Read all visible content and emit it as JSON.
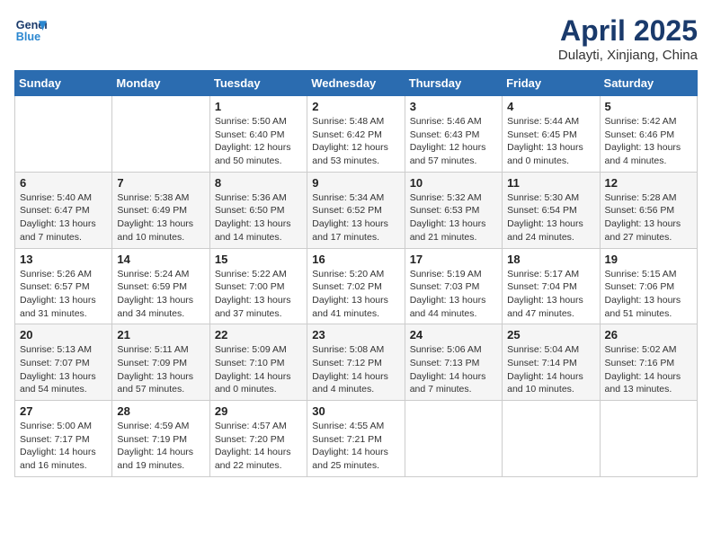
{
  "header": {
    "logo_line1": "General",
    "logo_line2": "Blue",
    "month_title": "April 2025",
    "location": "Dulayti, Xinjiang, China"
  },
  "weekdays": [
    "Sunday",
    "Monday",
    "Tuesday",
    "Wednesday",
    "Thursday",
    "Friday",
    "Saturday"
  ],
  "weeks": [
    [
      {
        "day": "",
        "info": ""
      },
      {
        "day": "",
        "info": ""
      },
      {
        "day": "1",
        "info": "Sunrise: 5:50 AM\nSunset: 6:40 PM\nDaylight: 12 hours and 50 minutes."
      },
      {
        "day": "2",
        "info": "Sunrise: 5:48 AM\nSunset: 6:42 PM\nDaylight: 12 hours and 53 minutes."
      },
      {
        "day": "3",
        "info": "Sunrise: 5:46 AM\nSunset: 6:43 PM\nDaylight: 12 hours and 57 minutes."
      },
      {
        "day": "4",
        "info": "Sunrise: 5:44 AM\nSunset: 6:45 PM\nDaylight: 13 hours and 0 minutes."
      },
      {
        "day": "5",
        "info": "Sunrise: 5:42 AM\nSunset: 6:46 PM\nDaylight: 13 hours and 4 minutes."
      }
    ],
    [
      {
        "day": "6",
        "info": "Sunrise: 5:40 AM\nSunset: 6:47 PM\nDaylight: 13 hours and 7 minutes."
      },
      {
        "day": "7",
        "info": "Sunrise: 5:38 AM\nSunset: 6:49 PM\nDaylight: 13 hours and 10 minutes."
      },
      {
        "day": "8",
        "info": "Sunrise: 5:36 AM\nSunset: 6:50 PM\nDaylight: 13 hours and 14 minutes."
      },
      {
        "day": "9",
        "info": "Sunrise: 5:34 AM\nSunset: 6:52 PM\nDaylight: 13 hours and 17 minutes."
      },
      {
        "day": "10",
        "info": "Sunrise: 5:32 AM\nSunset: 6:53 PM\nDaylight: 13 hours and 21 minutes."
      },
      {
        "day": "11",
        "info": "Sunrise: 5:30 AM\nSunset: 6:54 PM\nDaylight: 13 hours and 24 minutes."
      },
      {
        "day": "12",
        "info": "Sunrise: 5:28 AM\nSunset: 6:56 PM\nDaylight: 13 hours and 27 minutes."
      }
    ],
    [
      {
        "day": "13",
        "info": "Sunrise: 5:26 AM\nSunset: 6:57 PM\nDaylight: 13 hours and 31 minutes."
      },
      {
        "day": "14",
        "info": "Sunrise: 5:24 AM\nSunset: 6:59 PM\nDaylight: 13 hours and 34 minutes."
      },
      {
        "day": "15",
        "info": "Sunrise: 5:22 AM\nSunset: 7:00 PM\nDaylight: 13 hours and 37 minutes."
      },
      {
        "day": "16",
        "info": "Sunrise: 5:20 AM\nSunset: 7:02 PM\nDaylight: 13 hours and 41 minutes."
      },
      {
        "day": "17",
        "info": "Sunrise: 5:19 AM\nSunset: 7:03 PM\nDaylight: 13 hours and 44 minutes."
      },
      {
        "day": "18",
        "info": "Sunrise: 5:17 AM\nSunset: 7:04 PM\nDaylight: 13 hours and 47 minutes."
      },
      {
        "day": "19",
        "info": "Sunrise: 5:15 AM\nSunset: 7:06 PM\nDaylight: 13 hours and 51 minutes."
      }
    ],
    [
      {
        "day": "20",
        "info": "Sunrise: 5:13 AM\nSunset: 7:07 PM\nDaylight: 13 hours and 54 minutes."
      },
      {
        "day": "21",
        "info": "Sunrise: 5:11 AM\nSunset: 7:09 PM\nDaylight: 13 hours and 57 minutes."
      },
      {
        "day": "22",
        "info": "Sunrise: 5:09 AM\nSunset: 7:10 PM\nDaylight: 14 hours and 0 minutes."
      },
      {
        "day": "23",
        "info": "Sunrise: 5:08 AM\nSunset: 7:12 PM\nDaylight: 14 hours and 4 minutes."
      },
      {
        "day": "24",
        "info": "Sunrise: 5:06 AM\nSunset: 7:13 PM\nDaylight: 14 hours and 7 minutes."
      },
      {
        "day": "25",
        "info": "Sunrise: 5:04 AM\nSunset: 7:14 PM\nDaylight: 14 hours and 10 minutes."
      },
      {
        "day": "26",
        "info": "Sunrise: 5:02 AM\nSunset: 7:16 PM\nDaylight: 14 hours and 13 minutes."
      }
    ],
    [
      {
        "day": "27",
        "info": "Sunrise: 5:00 AM\nSunset: 7:17 PM\nDaylight: 14 hours and 16 minutes."
      },
      {
        "day": "28",
        "info": "Sunrise: 4:59 AM\nSunset: 7:19 PM\nDaylight: 14 hours and 19 minutes."
      },
      {
        "day": "29",
        "info": "Sunrise: 4:57 AM\nSunset: 7:20 PM\nDaylight: 14 hours and 22 minutes."
      },
      {
        "day": "30",
        "info": "Sunrise: 4:55 AM\nSunset: 7:21 PM\nDaylight: 14 hours and 25 minutes."
      },
      {
        "day": "",
        "info": ""
      },
      {
        "day": "",
        "info": ""
      },
      {
        "day": "",
        "info": ""
      }
    ]
  ]
}
